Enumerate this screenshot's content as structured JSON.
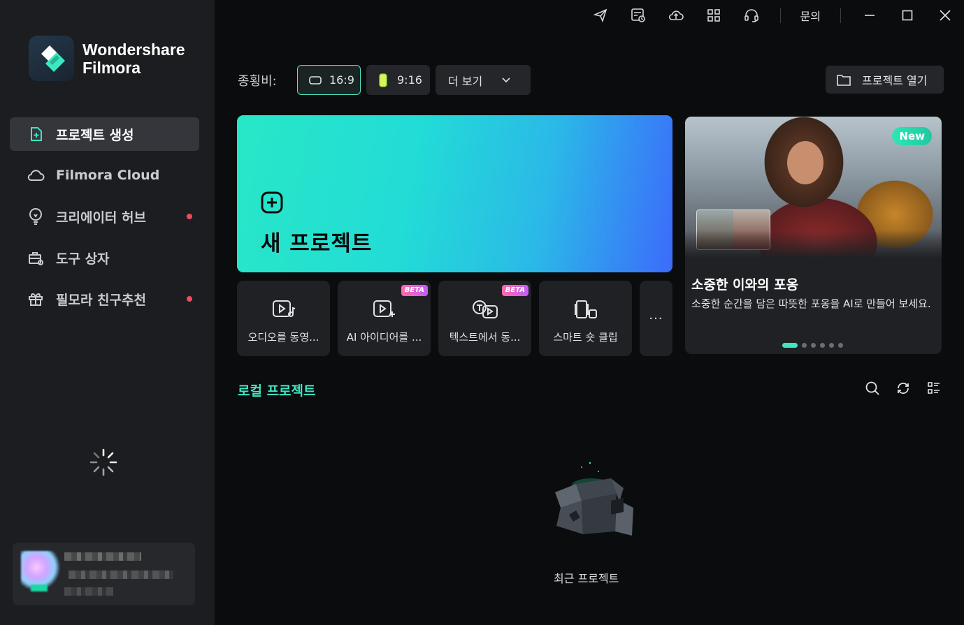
{
  "app": {
    "brand_line1": "Wondershare",
    "brand_line2": "Filmora",
    "accent_color": "#3ee6c2"
  },
  "titlebar": {
    "icons": [
      "send-icon",
      "schedule-icon",
      "cloud-upload-icon",
      "apps-grid-icon",
      "headset-icon"
    ],
    "inquiry_label": "문의",
    "window_controls": [
      "minimize-icon",
      "maximize-icon",
      "close-icon"
    ]
  },
  "sidebar": {
    "items": [
      {
        "label": "프로젝트 생성",
        "icon": "new-project-icon",
        "active": true,
        "dot": false
      },
      {
        "label": "Filmora Cloud",
        "icon": "cloud-icon",
        "active": false,
        "dot": false
      },
      {
        "label": "크리에이터 허브",
        "icon": "bulb-icon",
        "active": false,
        "dot": true
      },
      {
        "label": "도구 상자",
        "icon": "toolbox-icon",
        "active": false,
        "dot": false
      },
      {
        "label": "필모라 친구추천",
        "icon": "gift-icon",
        "active": false,
        "dot": true
      }
    ],
    "notification_dot_color": "#ef4b5c"
  },
  "aspect": {
    "label": "종횡비:",
    "options": [
      {
        "label": "16:9",
        "selected": true
      },
      {
        "label": "9:16",
        "selected": false
      }
    ],
    "more_label": "더 보기",
    "open_project_label": "프로젝트 열기"
  },
  "new_project": {
    "label": "새 프로젝트"
  },
  "tools": [
    {
      "label": "오디오를 동영...",
      "icon": "audio-to-video-icon",
      "beta": false
    },
    {
      "label": "AI 아이디어를 ...",
      "icon": "ai-idea-video-icon",
      "beta": true
    },
    {
      "label": "텍스트에서 동...",
      "icon": "text-to-video-icon",
      "beta": true
    },
    {
      "label": "스마트 숏 클립",
      "icon": "smart-short-clip-icon",
      "beta": false
    }
  ],
  "beta_label": "BETA",
  "more_tools_label": "···",
  "promo": {
    "badge": "New",
    "title": "소중한 이와의 포옹",
    "description": "소중한 순간을 담은 따뜻한 포옹을 AI로 만들어 보세요.",
    "slide_count": 6,
    "active_slide": 0
  },
  "local": {
    "title": "로컬 프로젝트",
    "tools": [
      "search-icon",
      "refresh-icon",
      "list-view-icon"
    ],
    "empty_label": "최근 프로젝트"
  }
}
